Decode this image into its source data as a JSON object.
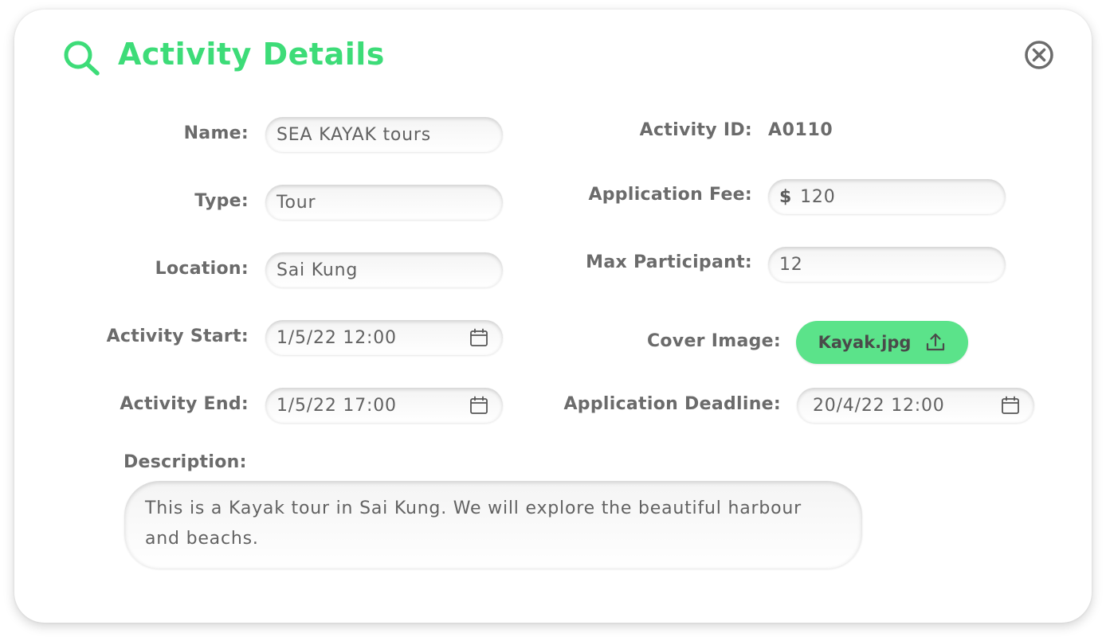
{
  "header": {
    "title": "Activity Details",
    "title_icon": "search-icon",
    "close_icon": "close-circle-icon",
    "accent_color": "#3ddc78"
  },
  "form": {
    "name": {
      "label": "Name:",
      "value": "SEA KAYAK tours"
    },
    "type": {
      "label": "Type:",
      "value": "Tour"
    },
    "location": {
      "label": "Location:",
      "value": "Sai Kung"
    },
    "activity_start": {
      "label": "Activity Start:",
      "value": "1/5/22 12:00",
      "icon": "calendar-icon"
    },
    "activity_end": {
      "label": "Activity End:",
      "value": "1/5/22 17:00",
      "icon": "calendar-icon"
    },
    "activity_id": {
      "label": "Activity ID:",
      "value": "A0110"
    },
    "application_fee": {
      "label": "Application Fee:",
      "currency": "$",
      "value": "120"
    },
    "max_participant": {
      "label": "Max Participant:",
      "value": "12"
    },
    "cover_image": {
      "label": "Cover Image:",
      "file": "Kayak.jpg",
      "icon": "upload-icon",
      "button_color": "#5be38a"
    },
    "application_deadline": {
      "label": "Application Deadline:",
      "value": "20/4/22 12:00",
      "icon": "calendar-icon"
    },
    "description": {
      "label": "Description:",
      "value": "This is a Kayak tour in Sai Kung. We will explore the beautiful harbour and beachs."
    }
  }
}
